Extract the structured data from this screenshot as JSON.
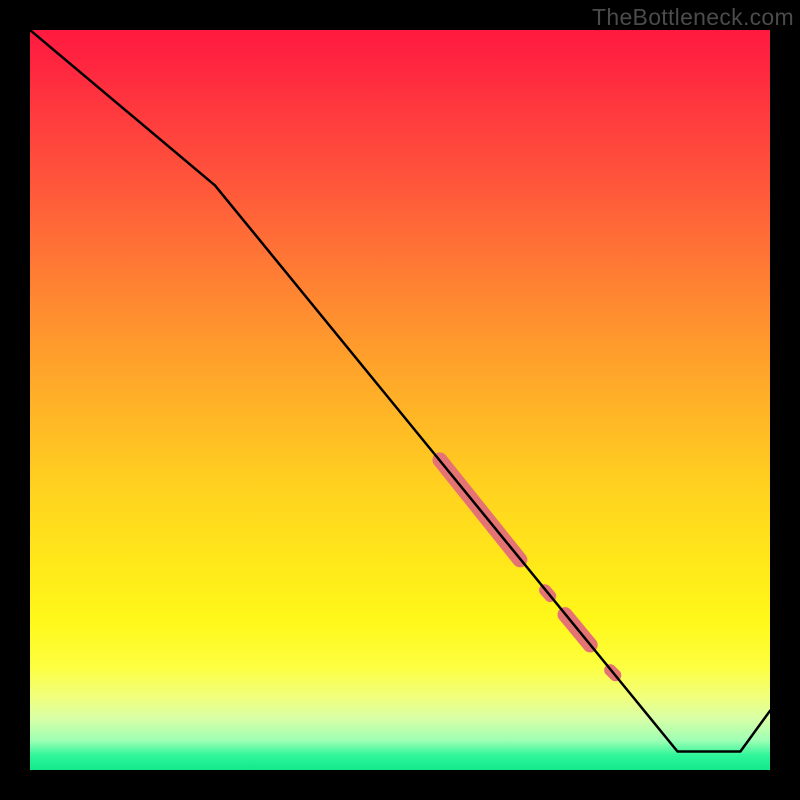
{
  "watermark": "TheBottleneck.com",
  "chart_data": {
    "type": "line",
    "title": "",
    "xlabel": "",
    "ylabel": "",
    "xlim": [
      0,
      100
    ],
    "ylim": [
      0,
      100
    ],
    "series": [
      {
        "name": "bottleneck-curve",
        "x": [
          0,
          25,
          87.5,
          96,
          100
        ],
        "y": [
          100,
          79,
          2.5,
          2.5,
          8
        ]
      }
    ],
    "highlights": [
      {
        "name": "highlight-segment-1",
        "x0": 55.4,
        "y0": 41.9,
        "x1": 66.2,
        "y1": 28.4,
        "thick": true
      },
      {
        "name": "highlight-dot-1",
        "x0": 69.6,
        "y0": 24.3,
        "x1": 70.3,
        "y1": 23.5,
        "thick": false
      },
      {
        "name": "highlight-segment-2",
        "x0": 72.3,
        "y0": 21.0,
        "x1": 75.7,
        "y1": 16.9,
        "thick": true
      },
      {
        "name": "highlight-dot-2",
        "x0": 78.4,
        "y0": 13.5,
        "x1": 79.1,
        "y1": 12.8,
        "thick": false
      }
    ],
    "colors": {
      "curve": "#000000",
      "highlight": "#e57373",
      "background_top": "#ff1a3f",
      "background_bottom": "#12e98c"
    }
  }
}
